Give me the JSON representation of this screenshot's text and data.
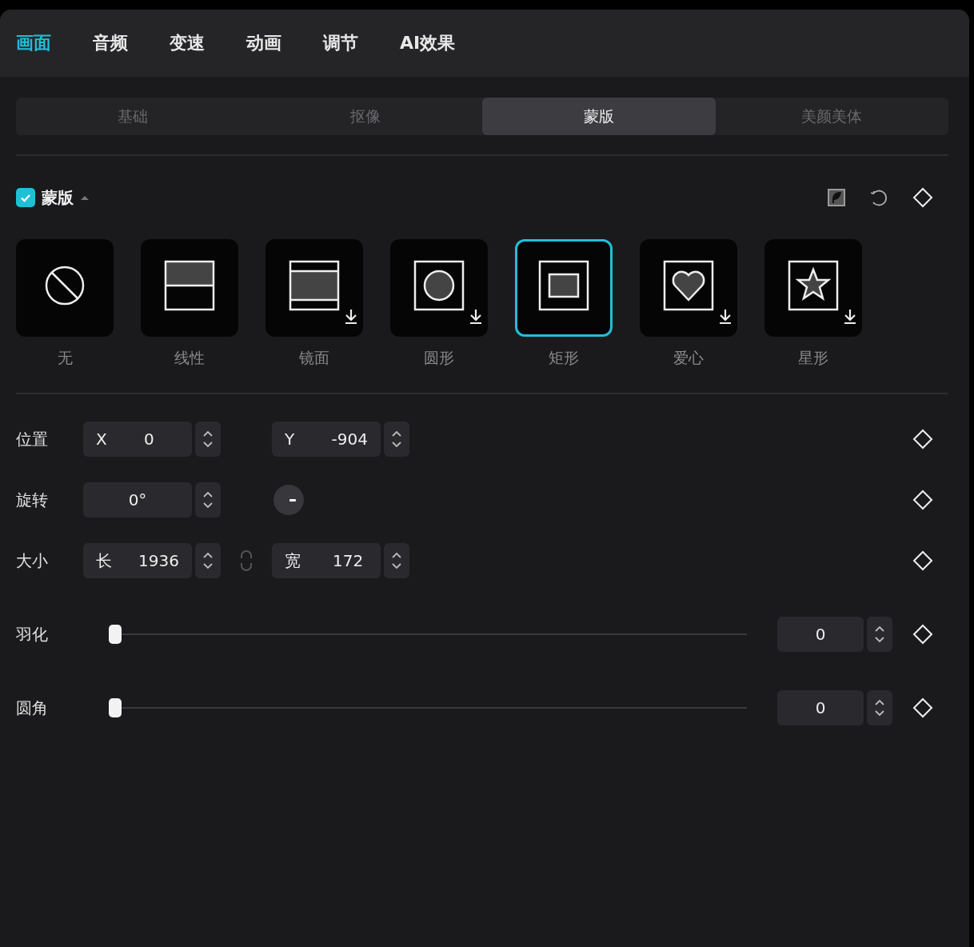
{
  "tabs": [
    {
      "label": "画面",
      "selected": true
    },
    {
      "label": "音频",
      "selected": false
    },
    {
      "label": "变速",
      "selected": false
    },
    {
      "label": "动画",
      "selected": false
    },
    {
      "label": "调节",
      "selected": false
    },
    {
      "label": "AI效果",
      "selected": false
    }
  ],
  "subtabs": [
    {
      "label": "基础",
      "selected": false
    },
    {
      "label": "抠像",
      "selected": false
    },
    {
      "label": "蒙版",
      "selected": true
    },
    {
      "label": "美颜美体",
      "selected": false
    }
  ],
  "mask_section": {
    "title": "蒙版",
    "checked": true,
    "expanded": true
  },
  "mask_shapes": [
    {
      "label": "无",
      "kind": "none",
      "selected": false,
      "downloadable": false
    },
    {
      "label": "线性",
      "kind": "linear",
      "selected": false,
      "downloadable": false
    },
    {
      "label": "镜面",
      "kind": "mirror",
      "selected": false,
      "downloadable": true
    },
    {
      "label": "圆形",
      "kind": "circle",
      "selected": false,
      "downloadable": true
    },
    {
      "label": "矩形",
      "kind": "rectangle",
      "selected": true,
      "downloadable": false
    },
    {
      "label": "爱心",
      "kind": "heart",
      "selected": false,
      "downloadable": true
    },
    {
      "label": "星形",
      "kind": "star",
      "selected": false,
      "downloadable": true
    }
  ],
  "position": {
    "label": "位置",
    "x": {
      "prefix": "X",
      "value": "0"
    },
    "y": {
      "prefix": "Y",
      "value": "-904"
    }
  },
  "rotation": {
    "label": "旋转",
    "value": "0°"
  },
  "size": {
    "label": "大小",
    "length": {
      "prefix": "长",
      "value": "1936"
    },
    "width": {
      "prefix": "宽",
      "value": "172"
    }
  },
  "sliders": [
    {
      "label": "羽化",
      "level": 0,
      "value": "0"
    },
    {
      "label": "圆角",
      "level": 0,
      "value": "0"
    }
  ]
}
